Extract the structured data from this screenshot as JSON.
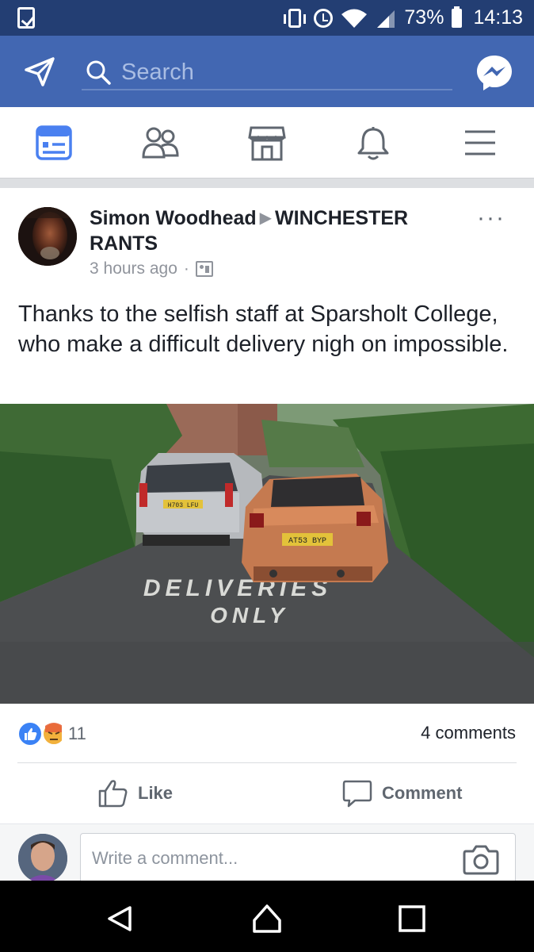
{
  "status_bar": {
    "battery": "73%",
    "time": "14:13"
  },
  "top_bar": {
    "search_placeholder": "Search"
  },
  "colors": {
    "brand_blue": "#4267b2",
    "status_bar": "#233e73",
    "active_tab": "#4a80f0",
    "secondary_text": "#90949c"
  },
  "nav": {
    "tabs": [
      {
        "name": "news-feed",
        "icon": "news-feed-icon",
        "active": true
      },
      {
        "name": "friends",
        "icon": "friends-icon",
        "active": false
      },
      {
        "name": "marketplace",
        "icon": "marketplace-icon",
        "active": false
      },
      {
        "name": "notifications",
        "icon": "bell-icon",
        "active": false
      },
      {
        "name": "menu",
        "icon": "hamburger-icon",
        "active": false
      }
    ]
  },
  "post": {
    "author": "Simon Woodhead",
    "group": "WINCHESTER RANTS",
    "time": "3 hours ago",
    "text": "Thanks to the selfish staff at Sparsholt College, who make a difficult delivery nigh on impossible.",
    "photo": {
      "plate_left": "H703 LFU",
      "plate_right": "AT53 BYP",
      "road_text_1": "DELIVERIES",
      "road_text_2": "ONLY"
    },
    "reactions": {
      "types": [
        "like",
        "angry"
      ],
      "count": "11"
    },
    "comments_count": "4 comments",
    "actions": {
      "like": "Like",
      "comment": "Comment"
    }
  },
  "composer": {
    "placeholder": "Write a comment..."
  }
}
